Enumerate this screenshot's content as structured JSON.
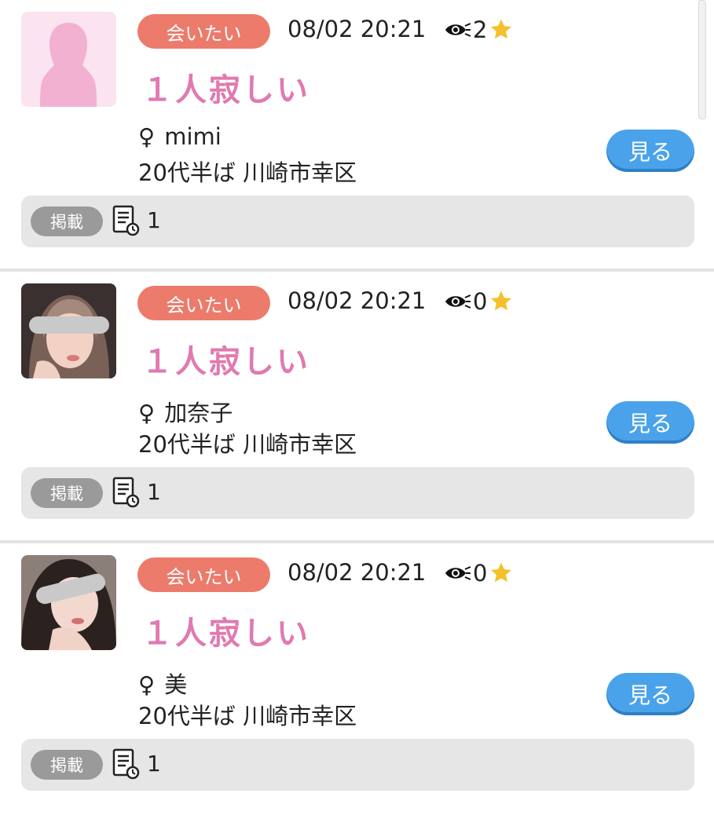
{
  "posts": [
    {
      "category": "会いたい",
      "date": "08/02 20:21",
      "view_count": "2",
      "title": "１人寂しい",
      "gender": "♀",
      "name": "mimi",
      "age_area": "20代半ば 川崎市幸区",
      "view_button": "見る",
      "posted_badge": "掲載",
      "post_count": "1",
      "avatar_type": "silhouette"
    },
    {
      "category": "会いたい",
      "date": "08/02 20:21",
      "view_count": "0",
      "title": "１人寂しい",
      "gender": "♀",
      "name": "加奈子",
      "age_area": "20代半ば 川崎市幸区",
      "view_button": "見る",
      "posted_badge": "掲載",
      "post_count": "1",
      "avatar_type": "photo"
    },
    {
      "category": "会いたい",
      "date": "08/02 20:21",
      "view_count": "0",
      "title": "１人寂しい",
      "gender": "♀",
      "name": "美",
      "age_area": "20代半ば 川崎市幸区",
      "view_button": "見る",
      "posted_badge": "掲載",
      "post_count": "1",
      "avatar_type": "photo"
    }
  ],
  "icons": {
    "views": "eye-icon",
    "favorite": "star-icon",
    "posts": "document-icon"
  },
  "colors": {
    "category_badge": "#ec7b6b",
    "title": "#e07ab0",
    "view_button": "#4aa3ea",
    "star": "#f5c02b",
    "posted_badge": "#9a9a9a"
  }
}
